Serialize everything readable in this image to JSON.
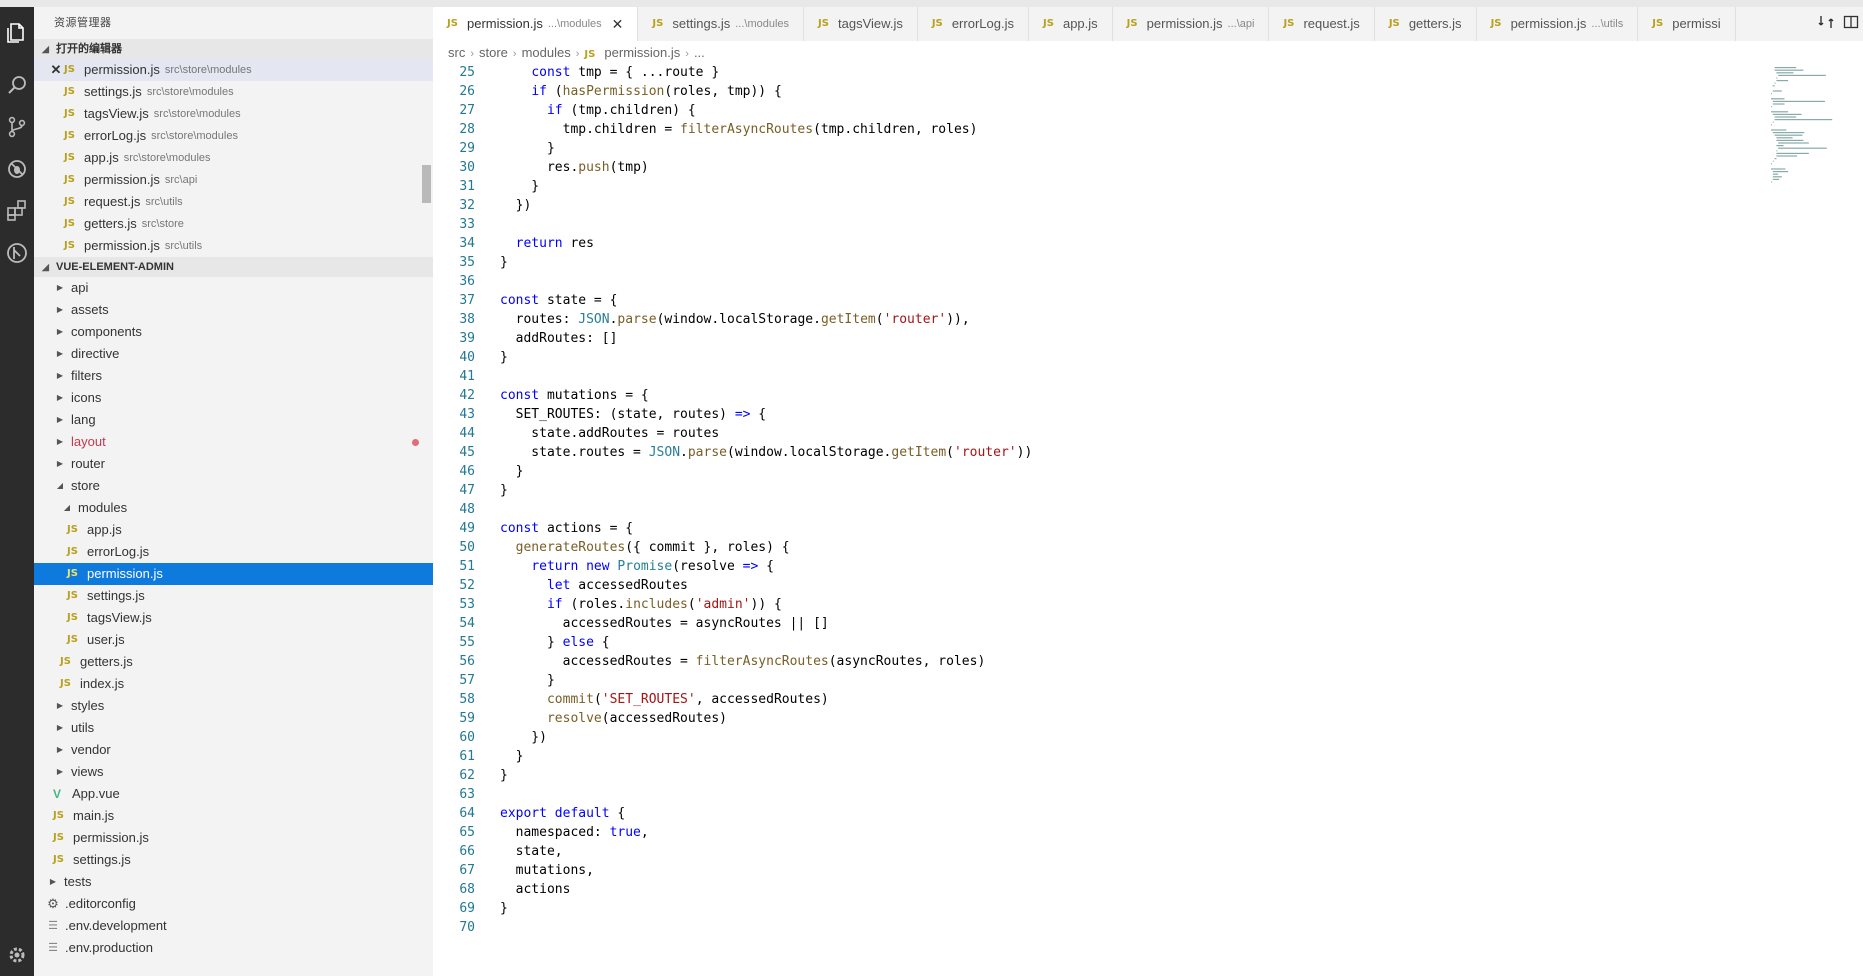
{
  "sidebar": {
    "title": "资源管理器",
    "open_editors_title": "打开的编辑器",
    "open_editors": [
      {
        "name": "permission.js",
        "path": "src\\store\\modules",
        "active": true
      },
      {
        "name": "settings.js",
        "path": "src\\store\\modules"
      },
      {
        "name": "tagsView.js",
        "path": "src\\store\\modules"
      },
      {
        "name": "errorLog.js",
        "path": "src\\store\\modules"
      },
      {
        "name": "app.js",
        "path": "src\\store\\modules"
      },
      {
        "name": "permission.js",
        "path": "src\\api"
      },
      {
        "name": "request.js",
        "path": "src\\utils"
      },
      {
        "name": "getters.js",
        "path": "src\\store"
      },
      {
        "name": "permission.js",
        "path": "src\\utils"
      }
    ],
    "project_title": "VUE-ELEMENT-ADMIN",
    "tree": [
      {
        "label": "api",
        "kind": "folder",
        "indent": 1
      },
      {
        "label": "assets",
        "kind": "folder",
        "indent": 1
      },
      {
        "label": "components",
        "kind": "folder",
        "indent": 1
      },
      {
        "label": "directive",
        "kind": "folder",
        "indent": 1
      },
      {
        "label": "filters",
        "kind": "folder",
        "indent": 1
      },
      {
        "label": "icons",
        "kind": "folder",
        "indent": 1
      },
      {
        "label": "lang",
        "kind": "folder",
        "indent": 1
      },
      {
        "label": "layout",
        "kind": "folder",
        "indent": 1,
        "color": "#c4384f",
        "dirty": true
      },
      {
        "label": "router",
        "kind": "folder",
        "indent": 1
      },
      {
        "label": "store",
        "kind": "folder-open",
        "indent": 1
      },
      {
        "label": "modules",
        "kind": "folder-open",
        "indent": 2
      },
      {
        "label": "app.js",
        "kind": "js",
        "indent": 3
      },
      {
        "label": "errorLog.js",
        "kind": "js",
        "indent": 3
      },
      {
        "label": "permission.js",
        "kind": "js",
        "indent": 3,
        "selected": true
      },
      {
        "label": "settings.js",
        "kind": "js",
        "indent": 3
      },
      {
        "label": "tagsView.js",
        "kind": "js",
        "indent": 3
      },
      {
        "label": "user.js",
        "kind": "js",
        "indent": 3
      },
      {
        "label": "getters.js",
        "kind": "js",
        "indent": 2
      },
      {
        "label": "index.js",
        "kind": "js",
        "indent": 2
      },
      {
        "label": "styles",
        "kind": "folder",
        "indent": 1
      },
      {
        "label": "utils",
        "kind": "folder",
        "indent": 1
      },
      {
        "label": "vendor",
        "kind": "folder",
        "indent": 1
      },
      {
        "label": "views",
        "kind": "folder",
        "indent": 1
      },
      {
        "label": "App.vue",
        "kind": "vue",
        "indent": 1
      },
      {
        "label": "main.js",
        "kind": "js",
        "indent": 1
      },
      {
        "label": "permission.js",
        "kind": "js",
        "indent": 1
      },
      {
        "label": "settings.js",
        "kind": "js",
        "indent": 1
      },
      {
        "label": "tests",
        "kind": "folder",
        "indent": 0
      },
      {
        "label": ".editorconfig",
        "kind": "gear",
        "indent": 0
      },
      {
        "label": ".env.development",
        "kind": "lines",
        "indent": 0
      },
      {
        "label": ".env.production",
        "kind": "lines",
        "indent": 0
      }
    ]
  },
  "tabs": [
    {
      "name": "permission.js",
      "desc": "...\\modules",
      "active": true
    },
    {
      "name": "settings.js",
      "desc": "...\\modules"
    },
    {
      "name": "tagsView.js",
      "desc": ""
    },
    {
      "name": "errorLog.js",
      "desc": ""
    },
    {
      "name": "app.js",
      "desc": ""
    },
    {
      "name": "permission.js",
      "desc": "...\\api"
    },
    {
      "name": "request.js",
      "desc": ""
    },
    {
      "name": "getters.js",
      "desc": ""
    },
    {
      "name": "permission.js",
      "desc": "...\\utils"
    },
    {
      "name": "permissi",
      "desc": ""
    }
  ],
  "js_label": "JS",
  "vue_label": "V",
  "breadcrumb": [
    "src",
    "store",
    "modules",
    "permission.js",
    "..."
  ],
  "code_lines": [
    {
      "n": "25",
      "t": [
        [
          "    ",
          ""
        ],
        [
          "const",
          "kw"
        ],
        [
          " tmp = { ...route }",
          ""
        ]
      ]
    },
    {
      "n": "26",
      "t": [
        [
          "    ",
          ""
        ],
        [
          "if",
          "kw"
        ],
        [
          " (",
          ""
        ],
        [
          "hasPermission",
          "fn"
        ],
        [
          "(roles, tmp)) {",
          ""
        ]
      ]
    },
    {
      "n": "27",
      "t": [
        [
          "      ",
          ""
        ],
        [
          "if",
          "kw"
        ],
        [
          " (tmp.children) {",
          ""
        ]
      ]
    },
    {
      "n": "28",
      "t": [
        [
          "        tmp.children = ",
          ""
        ],
        [
          "filterAsyncRoutes",
          "fn"
        ],
        [
          "(tmp.children, roles)",
          ""
        ]
      ]
    },
    {
      "n": "29",
      "t": [
        [
          "      }",
          ""
        ]
      ]
    },
    {
      "n": "30",
      "t": [
        [
          "      res.",
          ""
        ],
        [
          "push",
          "fn"
        ],
        [
          "(tmp)",
          ""
        ]
      ]
    },
    {
      "n": "31",
      "t": [
        [
          "    }",
          ""
        ]
      ]
    },
    {
      "n": "32",
      "t": [
        [
          "  })",
          ""
        ]
      ]
    },
    {
      "n": "33",
      "t": [
        [
          "",
          ""
        ]
      ]
    },
    {
      "n": "34",
      "t": [
        [
          "  ",
          ""
        ],
        [
          "return",
          "kw"
        ],
        [
          " res",
          ""
        ]
      ]
    },
    {
      "n": "35",
      "t": [
        [
          "}",
          ""
        ]
      ]
    },
    {
      "n": "36",
      "t": [
        [
          "",
          ""
        ]
      ]
    },
    {
      "n": "37",
      "t": [
        [
          "const",
          "kw"
        ],
        [
          " state = {",
          ""
        ]
      ]
    },
    {
      "n": "38",
      "t": [
        [
          "  routes: ",
          ""
        ],
        [
          "JSON",
          "cls"
        ],
        [
          ".",
          ""
        ],
        [
          "parse",
          "fn"
        ],
        [
          "(window.localStorage.",
          ""
        ],
        [
          "getItem",
          "fn"
        ],
        [
          "(",
          ""
        ],
        [
          "'router'",
          "str"
        ],
        [
          ")),",
          ""
        ]
      ]
    },
    {
      "n": "39",
      "t": [
        [
          "  addRoutes: []",
          ""
        ]
      ]
    },
    {
      "n": "40",
      "t": [
        [
          "}",
          ""
        ]
      ]
    },
    {
      "n": "41",
      "t": [
        [
          "",
          ""
        ]
      ]
    },
    {
      "n": "42",
      "t": [
        [
          "const",
          "kw"
        ],
        [
          " mutations = {",
          ""
        ]
      ]
    },
    {
      "n": "43",
      "t": [
        [
          "  SET_ROUTES: (state, routes) ",
          ""
        ],
        [
          "=>",
          "kw"
        ],
        [
          " {",
          ""
        ]
      ]
    },
    {
      "n": "44",
      "t": [
        [
          "    state.addRoutes = routes",
          ""
        ]
      ]
    },
    {
      "n": "45",
      "t": [
        [
          "    state.routes = ",
          ""
        ],
        [
          "JSON",
          "cls"
        ],
        [
          ".",
          ""
        ],
        [
          "parse",
          "fn"
        ],
        [
          "(window.localStorage.",
          ""
        ],
        [
          "getItem",
          "fn"
        ],
        [
          "(",
          ""
        ],
        [
          "'router'",
          "str"
        ],
        [
          "))",
          ""
        ]
      ]
    },
    {
      "n": "46",
      "t": [
        [
          "  }",
          ""
        ]
      ]
    },
    {
      "n": "47",
      "t": [
        [
          "}",
          ""
        ]
      ]
    },
    {
      "n": "48",
      "t": [
        [
          "",
          ""
        ]
      ]
    },
    {
      "n": "49",
      "t": [
        [
          "const",
          "kw"
        ],
        [
          " actions = {",
          ""
        ]
      ]
    },
    {
      "n": "50",
      "t": [
        [
          "  ",
          ""
        ],
        [
          "generateRoutes",
          "fn"
        ],
        [
          "({ commit }, roles) {",
          ""
        ]
      ]
    },
    {
      "n": "51",
      "t": [
        [
          "    ",
          ""
        ],
        [
          "return",
          "kw"
        ],
        [
          " ",
          ""
        ],
        [
          "new",
          "kw"
        ],
        [
          " ",
          ""
        ],
        [
          "Promise",
          "cls"
        ],
        [
          "(resolve ",
          ""
        ],
        [
          "=>",
          "kw"
        ],
        [
          " {",
          ""
        ]
      ]
    },
    {
      "n": "52",
      "t": [
        [
          "      ",
          ""
        ],
        [
          "let",
          "kw"
        ],
        [
          " accessedRoutes",
          ""
        ]
      ]
    },
    {
      "n": "53",
      "t": [
        [
          "      ",
          ""
        ],
        [
          "if",
          "kw"
        ],
        [
          " (roles.",
          ""
        ],
        [
          "includes",
          "fn"
        ],
        [
          "(",
          ""
        ],
        [
          "'admin'",
          "str"
        ],
        [
          ")) {",
          ""
        ]
      ]
    },
    {
      "n": "54",
      "t": [
        [
          "        accessedRoutes = asyncRoutes || []",
          ""
        ]
      ]
    },
    {
      "n": "55",
      "t": [
        [
          "      } ",
          ""
        ],
        [
          "else",
          "kw"
        ],
        [
          " {",
          ""
        ]
      ]
    },
    {
      "n": "56",
      "t": [
        [
          "        accessedRoutes = ",
          ""
        ],
        [
          "filterAsyncRoutes",
          "fn"
        ],
        [
          "(asyncRoutes, roles)",
          ""
        ]
      ]
    },
    {
      "n": "57",
      "t": [
        [
          "      }",
          ""
        ]
      ]
    },
    {
      "n": "58",
      "t": [
        [
          "      ",
          ""
        ],
        [
          "commit",
          "fn"
        ],
        [
          "(",
          ""
        ],
        [
          "'SET_ROUTES'",
          "str"
        ],
        [
          ", accessedRoutes)",
          ""
        ]
      ]
    },
    {
      "n": "59",
      "t": [
        [
          "      ",
          ""
        ],
        [
          "resolve",
          "fn"
        ],
        [
          "(accessedRoutes)",
          ""
        ]
      ]
    },
    {
      "n": "60",
      "t": [
        [
          "    })",
          ""
        ]
      ]
    },
    {
      "n": "61",
      "t": [
        [
          "  }",
          ""
        ]
      ]
    },
    {
      "n": "62",
      "t": [
        [
          "}",
          ""
        ]
      ]
    },
    {
      "n": "63",
      "t": [
        [
          "",
          ""
        ]
      ]
    },
    {
      "n": "64",
      "t": [
        [
          "export",
          "kw"
        ],
        [
          " ",
          ""
        ],
        [
          "default",
          "kw"
        ],
        [
          " {",
          ""
        ]
      ]
    },
    {
      "n": "65",
      "t": [
        [
          "  namespaced: ",
          ""
        ],
        [
          "true",
          "kw"
        ],
        [
          ",",
          ""
        ]
      ]
    },
    {
      "n": "66",
      "t": [
        [
          "  state,",
          ""
        ]
      ]
    },
    {
      "n": "67",
      "t": [
        [
          "  mutations,",
          ""
        ]
      ]
    },
    {
      "n": "68",
      "t": [
        [
          "  actions",
          ""
        ]
      ]
    },
    {
      "n": "69",
      "t": [
        [
          "}",
          ""
        ]
      ]
    },
    {
      "n": "70",
      "t": [
        [
          "",
          ""
        ]
      ]
    }
  ],
  "colors": {
    "accent": "#0e7add",
    "activity_bg": "#2c2c2c",
    "sidebar_bg": "#f3f3f3",
    "keyword": "#0000ff",
    "string": "#a31515",
    "function": "#795e26",
    "line_number": "#237893"
  }
}
